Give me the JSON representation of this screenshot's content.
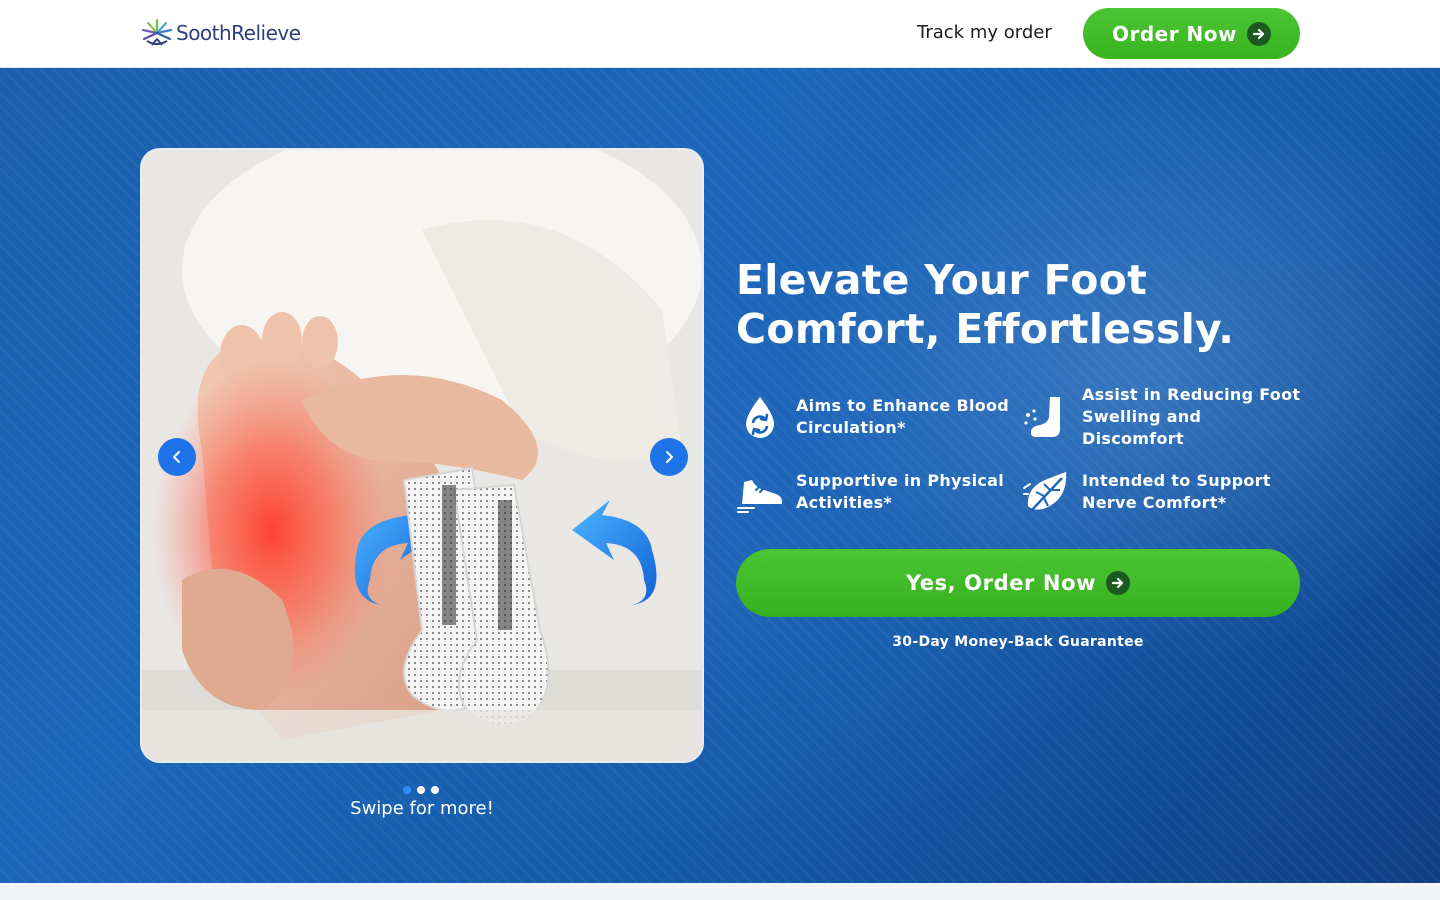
{
  "header": {
    "brand_name": "SoothRelieve",
    "track_label": "Track my order",
    "order_label": "Order Now"
  },
  "hero": {
    "headline": "Elevate Your Foot Comfort, Effortlessly.",
    "features": [
      {
        "icon": "drop-circulation-icon",
        "text": "Aims to Enhance  Blood Circulation*"
      },
      {
        "icon": "foot-swelling-icon",
        "text": "Assist in Reducing  Foot Swelling and Discomfort"
      },
      {
        "icon": "running-shoe-icon",
        "text": "Supportive in  Physical Activities*"
      },
      {
        "icon": "leaf-nerve-icon",
        "text": "Intended to Support Nerve Comfort*"
      }
    ],
    "cta_label": "Yes, Order Now",
    "guarantee": "30-Day Money-Back Guarantee"
  },
  "carousel": {
    "slide_count": 3,
    "active_slide": 1,
    "swipe_hint": "Swipe for more!"
  },
  "colors": {
    "brand_navy": "#2d3f7b",
    "accent_green": "#3fbb27",
    "hero_blue": "#1a66b8",
    "nav_blue": "#1e73e8"
  }
}
